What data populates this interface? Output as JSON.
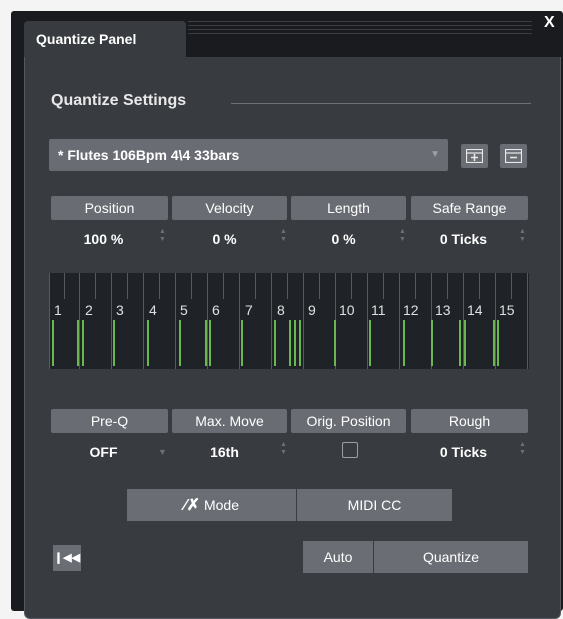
{
  "tab": {
    "title": "Quantize Panel",
    "close": "X"
  },
  "section": {
    "title": "Quantize Settings"
  },
  "preset": {
    "name": "* Flutes  106Bpm  4\\4  33bars"
  },
  "params_row1": [
    {
      "label": "Position",
      "value": "100 %"
    },
    {
      "label": "Velocity",
      "value": "0 %"
    },
    {
      "label": "Length",
      "value": "0 %"
    },
    {
      "label": "Safe Range",
      "value": "0 Ticks"
    }
  ],
  "grid": {
    "numbers": [
      "1",
      "2",
      "3",
      "4",
      "5",
      "6",
      "7",
      "8",
      "9",
      "10",
      "11",
      "12",
      "13",
      "14",
      "15"
    ]
  },
  "params_row2": [
    {
      "label": "Pre-Q",
      "value": "OFF"
    },
    {
      "label": "Max. Move",
      "value": "16th"
    },
    {
      "label": "Orig. Position",
      "value": ""
    },
    {
      "label": "Rough",
      "value": "0 Ticks"
    }
  ],
  "mode_row": {
    "mode_label": "Mode",
    "mode_icon": "swing-icon",
    "midi_label": "MIDI CC"
  },
  "bottom": {
    "auto_label": "Auto",
    "quantize_label": "Quantize",
    "rewind_icon": "skip-back-icon"
  },
  "colors": {
    "accent_green": "#68b74f",
    "panel": "#383b40",
    "button": "#696d73",
    "dark": "#1f2226"
  }
}
